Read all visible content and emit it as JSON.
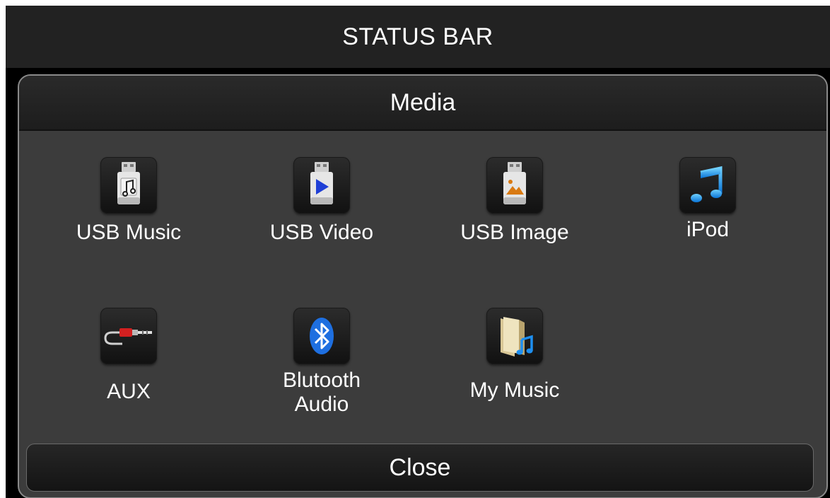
{
  "status_bar": {
    "title": "STATUS BAR"
  },
  "panel": {
    "title": "Media"
  },
  "items": [
    {
      "label": "USB Music",
      "icon": "usb-music-icon"
    },
    {
      "label": "USB Video",
      "icon": "usb-video-icon"
    },
    {
      "label": "USB Image",
      "icon": "usb-image-icon"
    },
    {
      "label": "iPod",
      "icon": "music-note-icon"
    },
    {
      "label": "AUX",
      "icon": "aux-cable-icon"
    },
    {
      "label_line1": "Blutooth",
      "label_line2": "Audio",
      "icon": "bluetooth-icon"
    },
    {
      "label": "My Music",
      "icon": "music-folder-icon"
    }
  ],
  "close_button": {
    "label": "Close"
  },
  "colors": {
    "accent_blue": "#1e90ff",
    "cable_red": "#d32020",
    "panel_background": "#3c3c3c"
  }
}
